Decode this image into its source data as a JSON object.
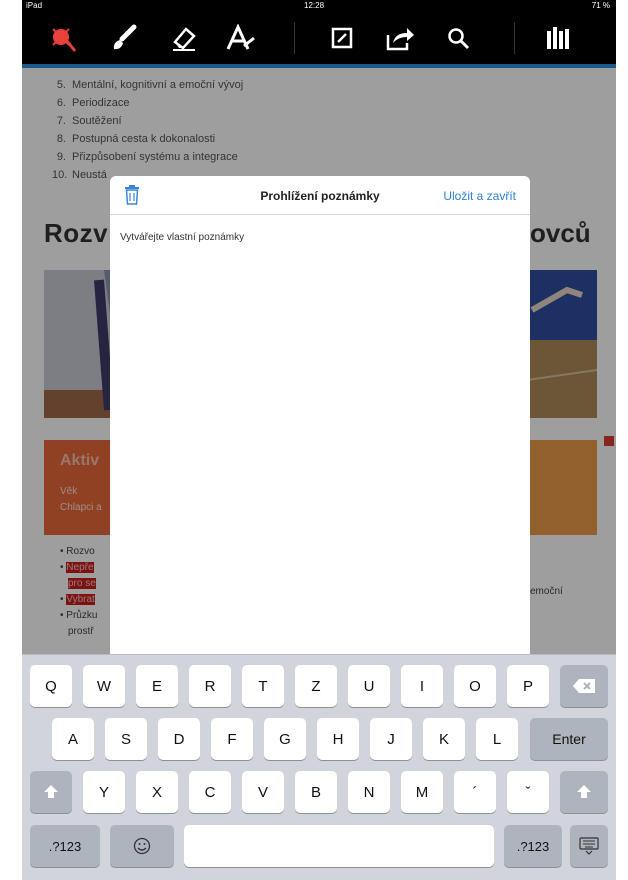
{
  "status_bar": {
    "carrier": "iPad",
    "time": "12:28",
    "battery": "71 %"
  },
  "toolbar": {
    "icons": [
      "pointer-icon",
      "brush-icon",
      "eraser-icon",
      "text-format-icon",
      "note-icon",
      "share-icon",
      "search-icon",
      "library-icon"
    ],
    "accent_color": "#e8413c"
  },
  "document": {
    "list": [
      {
        "num": "5.",
        "text": "Mentální, kognitivní a emoční vývoj"
      },
      {
        "num": "6.",
        "text": "Periodizace"
      },
      {
        "num": "7.",
        "text": "Soutěžení"
      },
      {
        "num": "8.",
        "text": "Postupná cesta k dokonalosti"
      },
      {
        "num": "9.",
        "text": "Přizpůsobení systému a integrace"
      },
      {
        "num": "10.",
        "text": "Neustá"
      }
    ],
    "heading_left": "Rozv",
    "heading_right": "ovců",
    "box_title": "Aktiv",
    "box_line1": "Věk",
    "box_line2": "Chlapci a",
    "bullets": [
      "Rozvo",
      "Nepře",
      "pro se",
      "Vybrat",
      "Průzku",
      "prostř"
    ],
    "bullet_right": "emoční"
  },
  "note_modal": {
    "title": "Prohlížení poznámky",
    "save_label": "Uložit a zavřít",
    "placeholder": "Vytvářejte vlastní poznámky"
  },
  "keyboard": {
    "row1": [
      "Q",
      "W",
      "E",
      "R",
      "T",
      "Z",
      "U",
      "I",
      "O",
      "P"
    ],
    "row2": [
      "A",
      "S",
      "D",
      "F",
      "G",
      "H",
      "J",
      "K",
      "L"
    ],
    "enter_label": "Enter",
    "row3": [
      "Y",
      "X",
      "C",
      "V",
      "B",
      "N",
      "M",
      "´",
      "ˇ"
    ],
    "numbers_label": ".?123",
    "numbers_label_right": ".?123"
  }
}
